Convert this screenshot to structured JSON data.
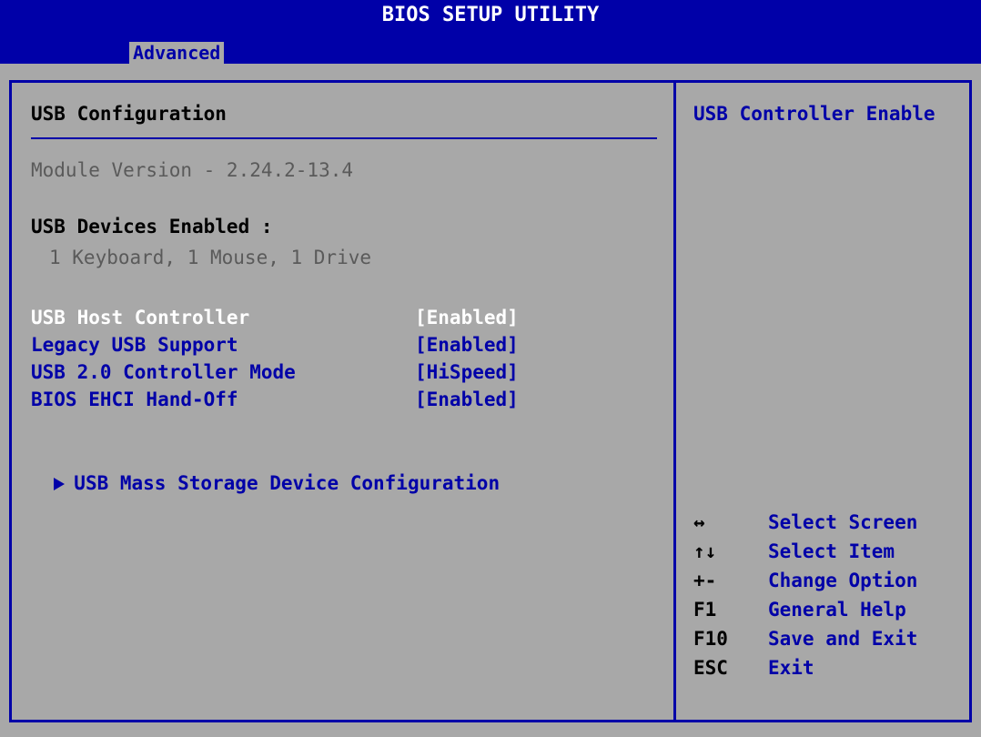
{
  "window": {
    "title": "BIOS SETUP UTILITY"
  },
  "tabs": {
    "active": "Advanced"
  },
  "main": {
    "section_title": "USB Configuration",
    "module_version": "Module Version - 2.24.2-13.4",
    "devices_label": "USB Devices Enabled :",
    "devices_value": "1 Keyboard, 1 Mouse, 1 Drive",
    "settings": [
      {
        "label": "USB Host Controller",
        "value": "[Enabled]"
      },
      {
        "label": "Legacy USB Support",
        "value": "[Enabled]"
      },
      {
        "label": "USB 2.0 Controller Mode",
        "value": "[HiSpeed]"
      },
      {
        "label": "BIOS EHCI Hand-Off",
        "value": "[Enabled]"
      }
    ],
    "submenu_label": "USB Mass Storage Device Configuration"
  },
  "help": {
    "title": "USB Controller Enable",
    "keys": [
      {
        "key": "↔",
        "desc": "Select Screen"
      },
      {
        "key": "↑↓",
        "desc": "Select Item"
      },
      {
        "key": "+-",
        "desc": "Change Option"
      },
      {
        "key": "F1",
        "desc": "General Help"
      },
      {
        "key": "F10",
        "desc": "Save and Exit"
      },
      {
        "key": "ESC",
        "desc": "Exit"
      }
    ]
  },
  "colors": {
    "background": "#a8a8a8",
    "bar": "#0000a8",
    "selected_text": "#ffffff",
    "option_text": "#0000a8"
  }
}
